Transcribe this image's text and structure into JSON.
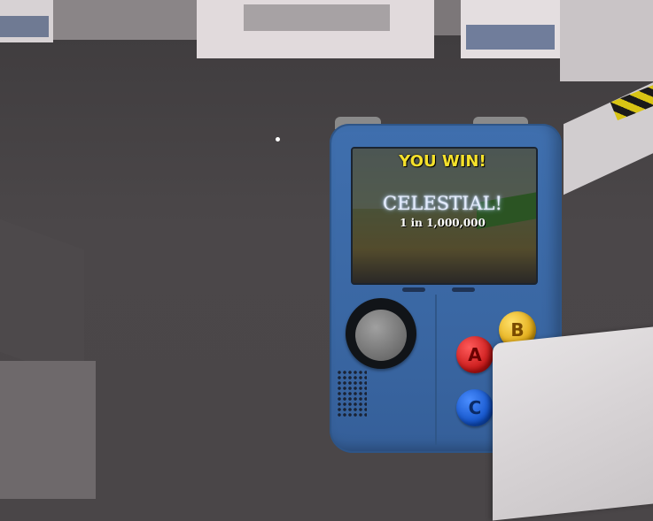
{
  "device": {
    "result_title": "YOU WIN!",
    "rarity_name": "CELESTIAL!",
    "odds": "1 in 1,000,000",
    "buttons": {
      "a": "A",
      "b": "B",
      "c": "C"
    }
  },
  "colors": {
    "device_body": "#3a67a3",
    "win_text": "#f5e12b",
    "button_a": "#d01c1c",
    "button_b": "#e8b11a",
    "button_c": "#1a5fd6"
  }
}
